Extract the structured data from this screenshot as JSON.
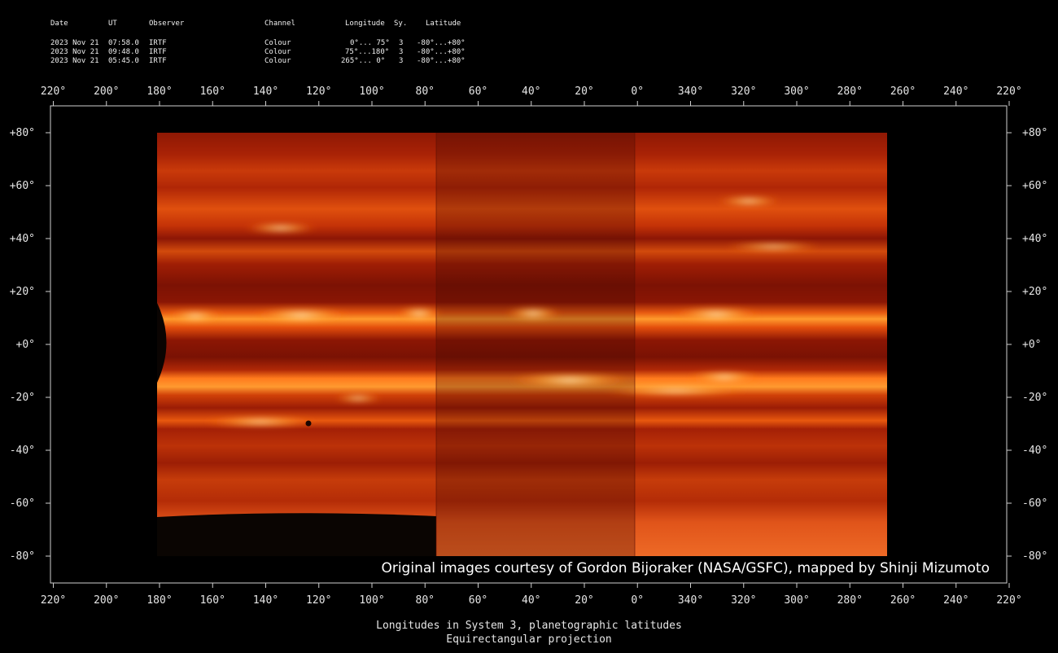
{
  "header": {
    "columns": [
      "Date",
      "UT",
      "Observer",
      "Channel",
      "Longitude",
      "Sy.",
      "Latitude"
    ],
    "rows": [
      {
        "date": "2023 Nov 21",
        "ut": "07:58.0",
        "observer": "IRTF",
        "channel": "Colour",
        "longitude": "0°... 75°",
        "system": "3",
        "latitude": "-80°...+80°"
      },
      {
        "date": "2023 Nov 21",
        "ut": "09:48.0",
        "observer": "IRTF",
        "channel": "Colour",
        "longitude": "75°...180°",
        "system": "3",
        "latitude": "-80°...+80°"
      },
      {
        "date": "2023 Nov 21",
        "ut": "05:45.0",
        "observer": "IRTF",
        "channel": "Colour",
        "longitude": "265°... 0°",
        "system": "3",
        "latitude": "-80°...+80°"
      }
    ]
  },
  "axes": {
    "longitude_labels": [
      "220°",
      "200°",
      "180°",
      "160°",
      "140°",
      "120°",
      "100°",
      "80°",
      "60°",
      "40°",
      "20°",
      "0°",
      "340°",
      "320°",
      "300°",
      "280°",
      "260°",
      "240°",
      "220°"
    ],
    "latitude_labels": [
      "+80°",
      "+60°",
      "+40°",
      "+20°",
      "+0°",
      "-20°",
      "-40°",
      "-60°",
      "-80°"
    ]
  },
  "credit": "Original images courtesy of Gordon Bijoraker (NASA/GSFC), mapped by Shinji Mizumoto",
  "footer": {
    "line1": "Longitudes in System 3, planetographic latitudes",
    "line2": "Equirectangular projection"
  },
  "colors": {
    "background": "#000000",
    "band_dark": "#7a1204",
    "band_mid": "#b82a06",
    "band_bright": "#ff6a10",
    "band_hot": "#ffe6a0"
  }
}
